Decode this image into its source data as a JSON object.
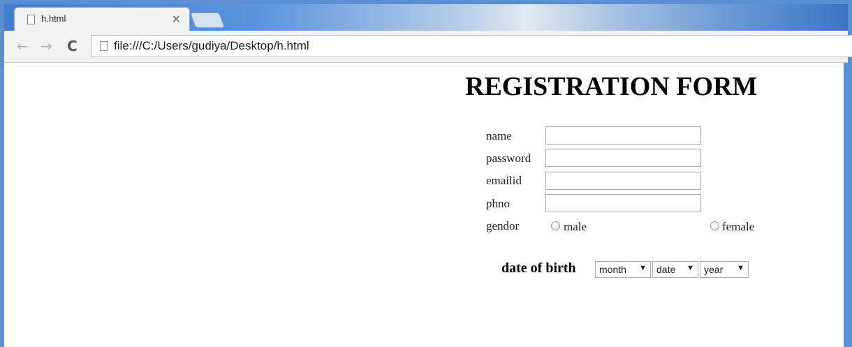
{
  "browser": {
    "tab_title": "h.html",
    "tab_close": "×",
    "nav_back": "←",
    "nav_forward": "→",
    "nav_reload": "C",
    "url": "file:///C:/Users/gudiya/Desktop/h.html"
  },
  "form": {
    "title": "REGISTRATION FORM",
    "fields": {
      "name_label": "name",
      "password_label": "password",
      "emailid_label": "emailid",
      "phno_label": "phno",
      "gender_label": "gendor"
    },
    "gender_options": {
      "male": "male",
      "female": "female"
    },
    "dob": {
      "label": "date of birth",
      "month": "month",
      "date": "date",
      "year": "year",
      "arrow": "▼"
    }
  },
  "colors": {
    "window_frame": "#5b8fd4",
    "toolbar": "#f2f2f2"
  }
}
